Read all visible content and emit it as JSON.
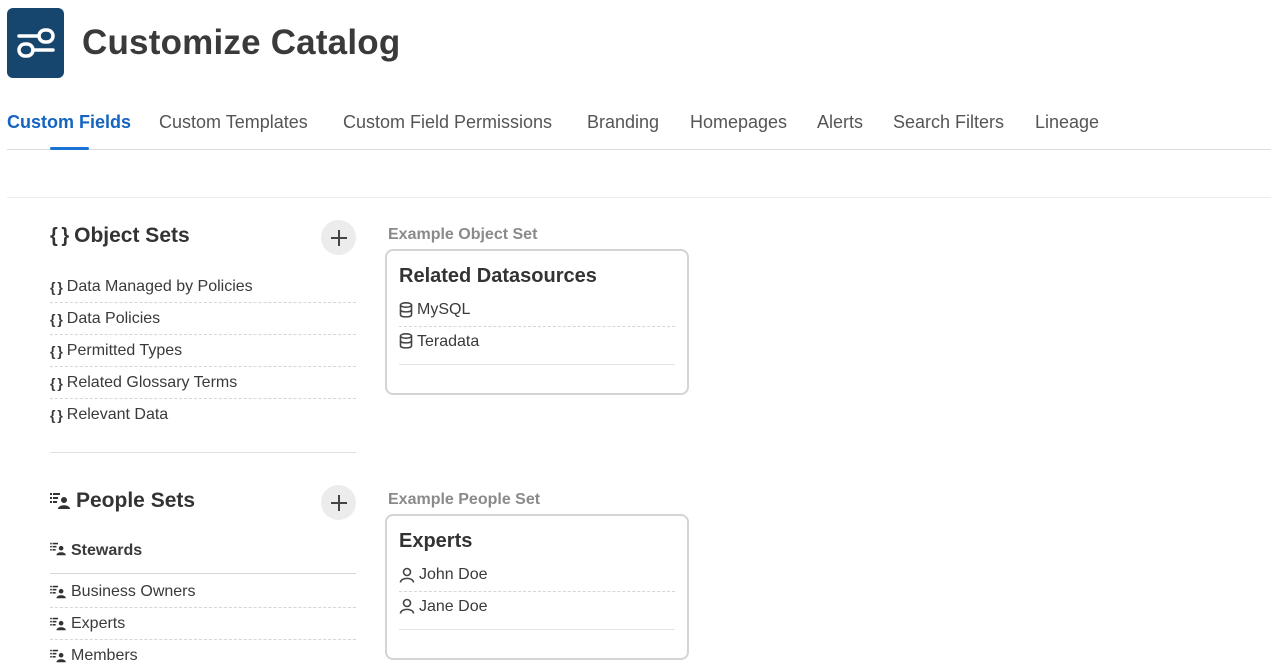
{
  "header": {
    "title": "Customize Catalog",
    "icon": "settings-sliders-icon"
  },
  "tabs": [
    {
      "label": "Custom Fields",
      "active": true
    },
    {
      "label": "Custom Templates"
    },
    {
      "label": "Custom Field Permissions"
    },
    {
      "label": "Branding"
    },
    {
      "label": "Homepages"
    },
    {
      "label": "Alerts"
    },
    {
      "label": "Search Filters"
    },
    {
      "label": "Lineage"
    }
  ],
  "object_sets": {
    "title": "Object Sets",
    "prefix": "{ }",
    "items": [
      "Data Managed by Policies",
      "Data Policies",
      "Permitted Types",
      "Related Glossary Terms",
      "Relevant Data"
    ],
    "example": {
      "label": "Example Object Set",
      "title": "Related Datasources",
      "rows": [
        "MySQL",
        "Teradata"
      ]
    }
  },
  "people_sets": {
    "title": "People Sets",
    "items": [
      "Stewards",
      "Business Owners",
      "Experts",
      "Members"
    ],
    "example": {
      "label": "Example People Set",
      "title": "Experts",
      "rows": [
        "John Doe",
        "Jane Doe"
      ]
    }
  },
  "colors": {
    "brand": "#16456e",
    "accent": "#1a73d4"
  }
}
